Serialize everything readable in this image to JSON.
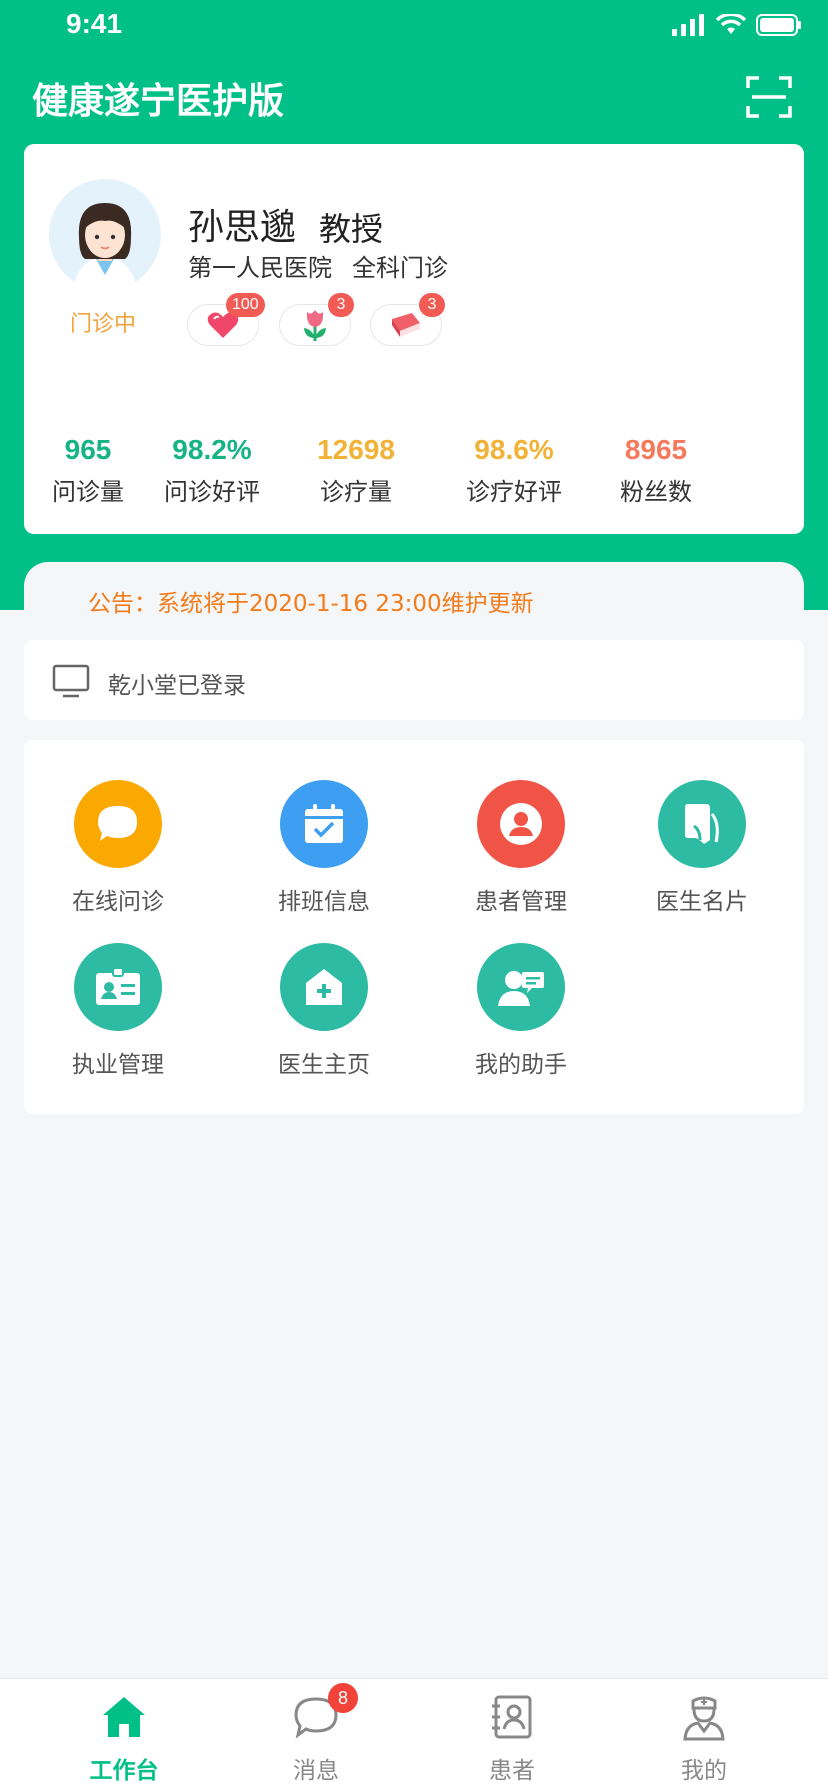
{
  "status_bar": {
    "time": "9:41"
  },
  "header": {
    "title": "健康遂宁医护版"
  },
  "profile": {
    "name": "孙思邈",
    "title": "教授",
    "hospital": "第一人民医院",
    "department": "全科门诊",
    "status": "门诊中",
    "badges": [
      {
        "icon": "heart-icon",
        "count": "100"
      },
      {
        "icon": "flower-icon",
        "count": "3"
      },
      {
        "icon": "book-icon",
        "count": "3"
      }
    ],
    "stats": [
      {
        "value": "965",
        "label": "问诊量",
        "color": "#16b386"
      },
      {
        "value": "98.2%",
        "label": "问诊好评",
        "color": "#16b386"
      },
      {
        "value": "12698",
        "label": "诊疗量",
        "color": "#f2b236"
      },
      {
        "value": "98.6%",
        "label": "诊疗好评",
        "color": "#f2b236"
      },
      {
        "value": "8965",
        "label": "粉丝数",
        "color": "#f47a5e"
      }
    ]
  },
  "notice": {
    "text": "公告：系统将于2020-1-16  23:00维护更新"
  },
  "login": {
    "text": "乾小堂已登录"
  },
  "menu": {
    "items": [
      {
        "label": "在线问诊",
        "icon": "chat-bubble-icon",
        "color": "#fba800"
      },
      {
        "label": "排班信息",
        "icon": "calendar-icon",
        "color": "#3d9ef2"
      },
      {
        "label": "患者管理",
        "icon": "patient-icon",
        "color": "#ef5446"
      },
      {
        "label": "医生名片",
        "icon": "card-icon",
        "color": "#2dbba4"
      },
      {
        "label": "执业管理",
        "icon": "id-card-icon",
        "color": "#2dbba4"
      },
      {
        "label": "医生主页",
        "icon": "home-plus-icon",
        "color": "#2dbba4"
      },
      {
        "label": "我的助手",
        "icon": "assistant-icon",
        "color": "#2dbba4"
      }
    ]
  },
  "tabs": [
    {
      "label": "工作台",
      "icon": "home-icon",
      "active": true
    },
    {
      "label": "消息",
      "icon": "message-icon",
      "badge": "8"
    },
    {
      "label": "患者",
      "icon": "contacts-icon"
    },
    {
      "label": "我的",
      "icon": "doctor-icon"
    }
  ],
  "colors": {
    "brand": "#00c087",
    "notice": "#f27b1a",
    "badge": "#f25a54"
  }
}
